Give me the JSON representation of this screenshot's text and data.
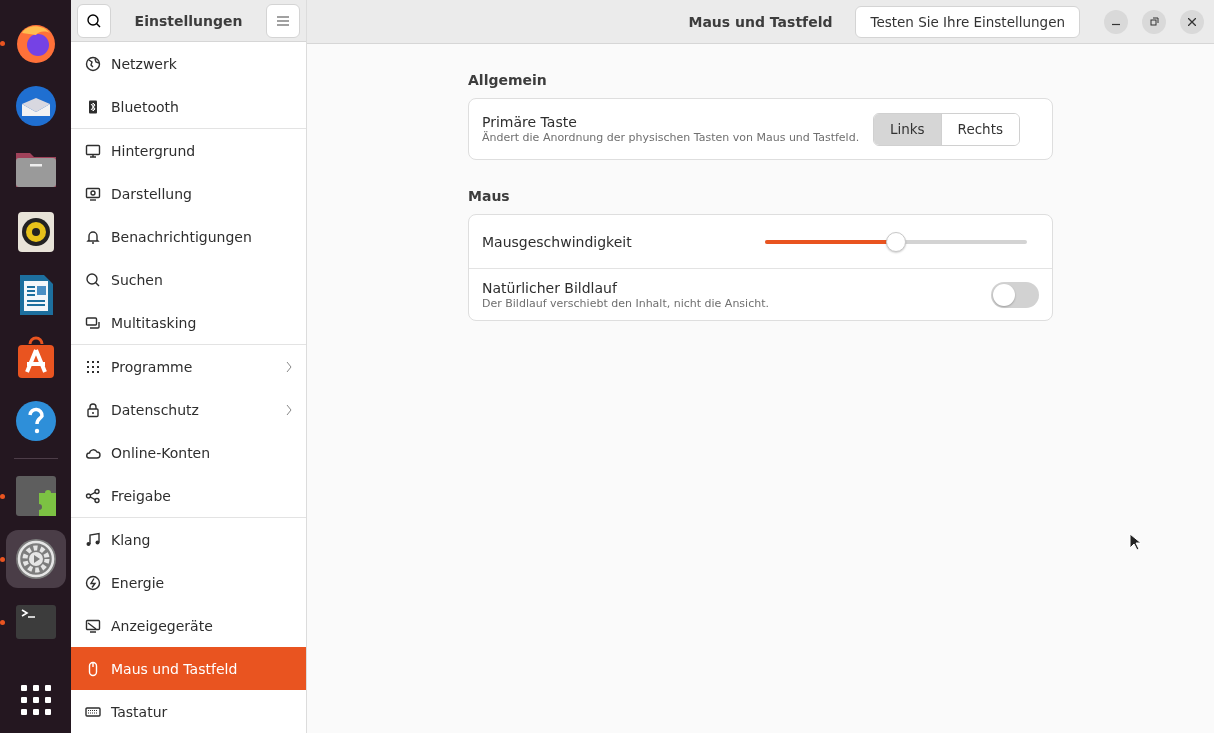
{
  "dock": {
    "apps": [
      {
        "kind": "firefox",
        "running": true,
        "selected": false
      },
      {
        "kind": "thunderbird",
        "running": false,
        "selected": false
      },
      {
        "kind": "files",
        "running": false,
        "selected": false
      },
      {
        "kind": "rhythmbox",
        "running": false,
        "selected": false
      },
      {
        "kind": "writer",
        "running": false,
        "selected": false
      },
      {
        "kind": "store",
        "running": false,
        "selected": false
      },
      {
        "kind": "help",
        "running": false,
        "selected": false
      },
      {
        "kind": "separator"
      },
      {
        "kind": "extensions",
        "running": true,
        "selected": false
      },
      {
        "kind": "settings",
        "running": true,
        "selected": true
      },
      {
        "kind": "terminal",
        "running": true,
        "selected": false
      }
    ]
  },
  "sidebar": {
    "title": "Einstellungen",
    "groups": [
      [
        {
          "label": "Netzwerk",
          "selected": false,
          "submenu": false
        },
        {
          "label": "Bluetooth",
          "selected": false,
          "submenu": false
        }
      ],
      [
        {
          "label": "Hintergrund",
          "selected": false,
          "submenu": false
        },
        {
          "label": "Darstellung",
          "selected": false,
          "submenu": false
        },
        {
          "label": "Benachrichtigungen",
          "selected": false,
          "submenu": false
        },
        {
          "label": "Suchen",
          "selected": false,
          "submenu": false
        },
        {
          "label": "Multitasking",
          "selected": false,
          "submenu": false
        }
      ],
      [
        {
          "label": "Programme",
          "selected": false,
          "submenu": true
        },
        {
          "label": "Datenschutz",
          "selected": false,
          "submenu": true
        },
        {
          "label": "Online-Konten",
          "selected": false,
          "submenu": false
        },
        {
          "label": "Freigabe",
          "selected": false,
          "submenu": false
        }
      ],
      [
        {
          "label": "Klang",
          "selected": false,
          "submenu": false
        },
        {
          "label": "Energie",
          "selected": false,
          "submenu": false
        },
        {
          "label": "Anzeigegeräte",
          "selected": false,
          "submenu": false
        },
        {
          "label": "Maus und Tastfeld",
          "selected": true,
          "submenu": false
        },
        {
          "label": "Tastatur",
          "selected": false,
          "submenu": false
        }
      ]
    ]
  },
  "header": {
    "title": "Maus und Tastfeld",
    "test_button": "Testen Sie Ihre Einstellungen"
  },
  "sections": [
    {
      "title": "Allgemein",
      "rows": [
        {
          "kind": "choice",
          "label": "Primäre Taste",
          "description": "Ändert die Anordnung der physischen Tasten von Maus und Tastfeld.",
          "options": [
            {
              "label": "Links",
              "selected": true
            },
            {
              "label": "Rechts",
              "selected": false
            }
          ]
        }
      ]
    },
    {
      "title": "Maus",
      "rows": [
        {
          "kind": "slider",
          "label": "Mausgeschwindigkeit",
          "level": 0.5
        },
        {
          "kind": "switch",
          "label": "Natürlicher Bildlauf",
          "description": "Der Bildlauf verschiebt den Inhalt, nicht die Ansicht.",
          "on": false
        }
      ]
    }
  ]
}
